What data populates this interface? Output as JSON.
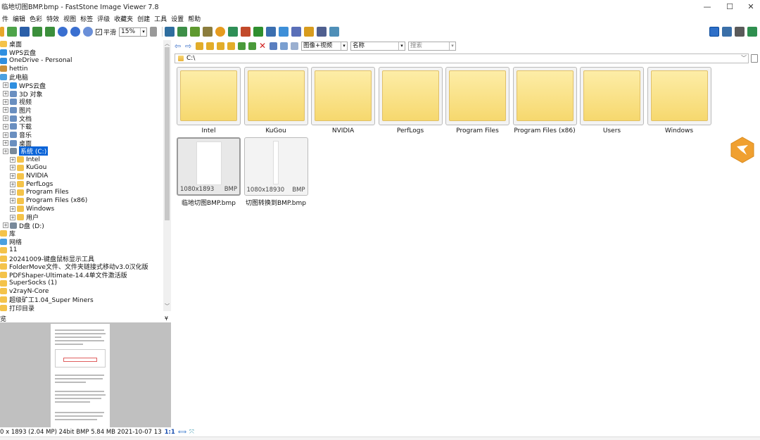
{
  "window": {
    "title": "临地切图BMP.bmp  -  FastStone Image Viewer 7.8",
    "controls": {
      "minimize": "—",
      "maximize": "☐",
      "close": "✕"
    }
  },
  "menu": [
    "件",
    "编辑",
    "色彩",
    "特效",
    "视图",
    "标签",
    "评级",
    "收藏夹",
    "创建",
    "工具",
    "设置",
    "帮助"
  ],
  "toolbar": {
    "smooth_label": "平滑",
    "zoom_value": "15%"
  },
  "tree": {
    "items": [
      {
        "label": "桌面",
        "indent": 0
      },
      {
        "label": "WPS云盘",
        "indent": 0
      },
      {
        "label": "OneDrive - Personal",
        "indent": 0
      },
      {
        "label": "hettin",
        "indent": 0
      },
      {
        "label": "此电脑",
        "indent": 0
      },
      {
        "label": "WPS云盘",
        "indent": 1
      },
      {
        "label": "3D 对象",
        "indent": 1
      },
      {
        "label": "视频",
        "indent": 1
      },
      {
        "label": "图片",
        "indent": 1
      },
      {
        "label": "文档",
        "indent": 1
      },
      {
        "label": "下载",
        "indent": 1
      },
      {
        "label": "音乐",
        "indent": 1
      },
      {
        "label": "桌面",
        "indent": 1
      },
      {
        "label": "系统 (C:)",
        "indent": 1,
        "selected": true
      },
      {
        "label": "Intel",
        "indent": 2
      },
      {
        "label": "KuGou",
        "indent": 2
      },
      {
        "label": "NVIDIA",
        "indent": 2
      },
      {
        "label": "PerfLogs",
        "indent": 2
      },
      {
        "label": "Program Files",
        "indent": 2
      },
      {
        "label": "Program Files (x86)",
        "indent": 2
      },
      {
        "label": "Windows",
        "indent": 2
      },
      {
        "label": "用户",
        "indent": 2
      },
      {
        "label": "D盘 (D:)",
        "indent": 1
      },
      {
        "label": "库",
        "indent": 0
      },
      {
        "label": "网络",
        "indent": 0
      },
      {
        "label": "11",
        "indent": 0
      },
      {
        "label": "20241009-键盘鼠标显示工具",
        "indent": 0
      },
      {
        "label": "FolderMove文件、文件夹链接式移动v3.0汉化版",
        "indent": 0
      },
      {
        "label": "PDFShaper-Ultimate-14.4单文件激活版",
        "indent": 0
      },
      {
        "label": "SuperSocks (1)",
        "indent": 0
      },
      {
        "label": "v2rayN-Core",
        "indent": 0
      },
      {
        "label": "超级矿工1.04_Super Miners",
        "indent": 0
      },
      {
        "label": "打印目录",
        "indent": 0
      }
    ]
  },
  "preview": {
    "header": "览",
    "status": "0 x 1893 (2.04 MP)  24bit  BMP   5.84 MB   2021-10-07 13",
    "ratio": "1:1"
  },
  "browser": {
    "view_mode": "图像+视频",
    "sort_by": "名称",
    "search_placeholder": "搜索",
    "path": "C:\\",
    "folders": [
      "Intel",
      "KuGou",
      "NVIDIA",
      "PerfLogs",
      "Program Files",
      "Program Files (x86)",
      "Users",
      "Windows"
    ],
    "files": [
      {
        "name": "临地切图BMP.bmp",
        "dims": "1080x1893",
        "type": "BMP"
      },
      {
        "name": "切图转换到BMP.bmp",
        "dims": "1080x18930",
        "type": "BMP"
      }
    ]
  }
}
